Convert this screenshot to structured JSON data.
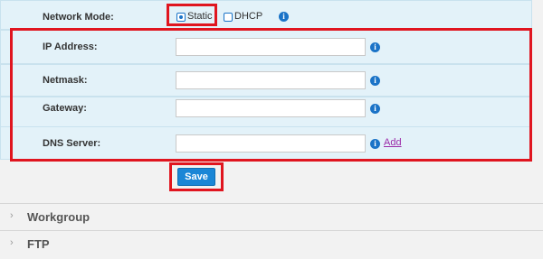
{
  "network_mode": {
    "label": "Network Mode:",
    "options": [
      {
        "label": "Static",
        "selected": true
      },
      {
        "label": "DHCP",
        "selected": false
      }
    ]
  },
  "fields": {
    "ip_address": {
      "label": "IP Address:",
      "value": ""
    },
    "netmask": {
      "label": "Netmask:",
      "value": ""
    },
    "gateway": {
      "label": "Gateway:",
      "value": ""
    },
    "dns_server": {
      "label": "DNS Server:",
      "value": "",
      "add_label": "Add"
    }
  },
  "save_label": "Save",
  "sections": [
    {
      "title": "Workgroup"
    },
    {
      "title": "FTP"
    }
  ],
  "colors": {
    "row_background": "#e3f2f9",
    "accent": "#1a73c7",
    "highlight_box": "#e0151f",
    "link": "#9b2aa8"
  },
  "icons": {
    "info": "info-icon",
    "section_chevron": "chevron-right-icon"
  }
}
